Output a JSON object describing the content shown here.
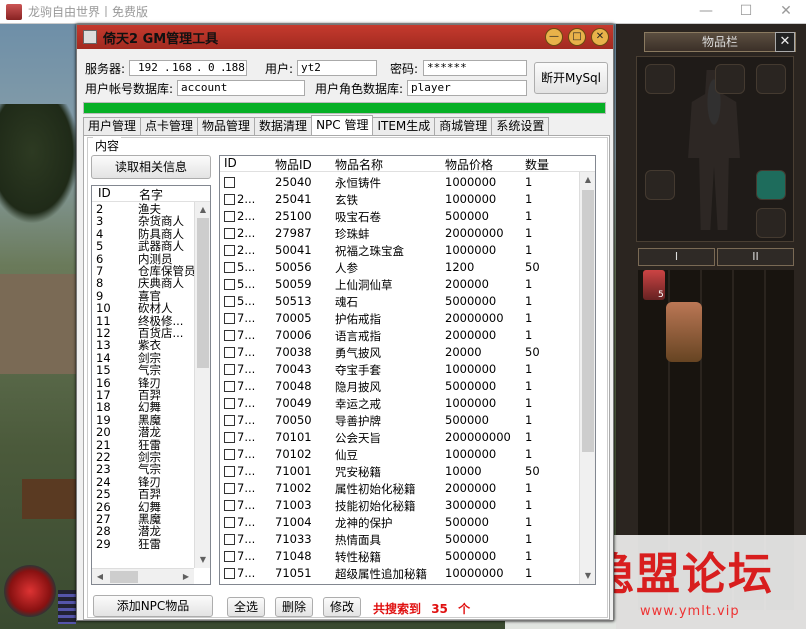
{
  "outer_window": {
    "title": "龙驹自由世界丨免费版",
    "minimize": "—",
    "maximize": "☐",
    "close": "✕"
  },
  "inventory": {
    "title": "物品栏",
    "close": "✕",
    "tab1": "I",
    "tab2": "II",
    "item_count": "5"
  },
  "watermark": {
    "brand": "隐盟论坛",
    "url": "www.ymlt.vip"
  },
  "dialog": {
    "title": "倚天2 GM管理工具",
    "server_label": "服务器:",
    "ip": [
      "192",
      "168",
      "0",
      "188"
    ],
    "user_label": "用户:",
    "user_value": "yt2",
    "password_label": "密码:",
    "password_value": "******",
    "account_db_label": "用户帐号数据库:",
    "account_db_value": "account",
    "role_db_label": "用户角色数据库:",
    "role_db_value": "player",
    "disconnect_button": "断开MySql",
    "progress": 1.0,
    "tabs": [
      "用户管理",
      "点卡管理",
      "物品管理",
      "数据清理",
      "NPC 管理",
      "ITEM生成",
      "商城管理",
      "系统设置"
    ],
    "active_tab": "NPC 管理",
    "group_label": "内容",
    "read_button": "读取相关信息",
    "npc_list": {
      "headers": [
        "ID",
        "名字"
      ],
      "rows": [
        [
          "2",
          "渔夫"
        ],
        [
          "3",
          "杂货商人"
        ],
        [
          "4",
          "防具商人"
        ],
        [
          "5",
          "武器商人"
        ],
        [
          "6",
          "内测员"
        ],
        [
          "7",
          "仓库保管员"
        ],
        [
          "8",
          "庆典商人"
        ],
        [
          "9",
          "喜官"
        ],
        [
          "10",
          "砍材人"
        ],
        [
          "11",
          "终极修..."
        ],
        [
          "12",
          "百货店..."
        ],
        [
          "13",
          "紫衣"
        ],
        [
          "14",
          "剑宗"
        ],
        [
          "15",
          "气宗"
        ],
        [
          "16",
          "锋刃"
        ],
        [
          "17",
          "百羿"
        ],
        [
          "18",
          "幻舞"
        ],
        [
          "19",
          "黑魔"
        ],
        [
          "20",
          "潜龙"
        ],
        [
          "21",
          "狂雷"
        ],
        [
          "22",
          "剑宗"
        ],
        [
          "23",
          "气宗"
        ],
        [
          "24",
          "锋刃"
        ],
        [
          "25",
          "百羿"
        ],
        [
          "26",
          "幻舞"
        ],
        [
          "27",
          "黑魔"
        ],
        [
          "28",
          "潜龙"
        ],
        [
          "29",
          "狂雷"
        ]
      ]
    },
    "add_npc_button": "添加NPC物品",
    "item_list": {
      "headers": [
        "ID",
        "物品ID",
        "物品名称",
        "物品价格",
        "数量"
      ],
      "rows": [
        [
          "",
          "25040",
          "永恒铸件",
          "1000000",
          "1"
        ],
        [
          "2...",
          "25041",
          "玄铁",
          "1000000",
          "1"
        ],
        [
          "2...",
          "25100",
          "吸宝石卷",
          "500000",
          "1"
        ],
        [
          "2...",
          "27987",
          "珍珠蚌",
          "20000000",
          "1"
        ],
        [
          "2...",
          "50041",
          "祝福之珠宝盒",
          "1000000",
          "1"
        ],
        [
          "5...",
          "50056",
          "人参",
          "1200",
          "50"
        ],
        [
          "5...",
          "50059",
          "上仙洞仙草",
          "200000",
          "1"
        ],
        [
          "5...",
          "50513",
          "魂石",
          "5000000",
          "1"
        ],
        [
          "7...",
          "70005",
          "护佑戒指",
          "20000000",
          "1"
        ],
        [
          "7...",
          "70006",
          "语言戒指",
          "2000000",
          "1"
        ],
        [
          "7...",
          "70038",
          "勇气披风",
          "20000",
          "50"
        ],
        [
          "7...",
          "70043",
          "夺宝手套",
          "1000000",
          "1"
        ],
        [
          "7...",
          "70048",
          "隐月披风",
          "5000000",
          "1"
        ],
        [
          "7...",
          "70049",
          "幸运之戒",
          "1000000",
          "1"
        ],
        [
          "7...",
          "70050",
          "导善护牌",
          "500000",
          "1"
        ],
        [
          "7...",
          "70101",
          "公会天旨",
          "200000000",
          "1"
        ],
        [
          "7...",
          "70102",
          "仙豆",
          "1000000",
          "1"
        ],
        [
          "7...",
          "71001",
          "咒安秘籍",
          "10000",
          "50"
        ],
        [
          "7...",
          "71002",
          "属性初始化秘籍",
          "2000000",
          "1"
        ],
        [
          "7...",
          "71003",
          "技能初始化秘籍",
          "3000000",
          "1"
        ],
        [
          "7...",
          "71004",
          "龙神的保护",
          "500000",
          "1"
        ],
        [
          "7...",
          "71033",
          "热情面具",
          "500000",
          "1"
        ],
        [
          "7...",
          "71048",
          "转性秘籍",
          "5000000",
          "1"
        ],
        [
          "7...",
          "71051",
          "超级属性追加秘籍",
          "10000000",
          "1"
        ]
      ]
    },
    "select_all_button": "全选",
    "delete_button": "删除",
    "modify_button": "修改",
    "status_prefix": "共搜索到",
    "status_count": "35",
    "status_suffix": "个"
  }
}
